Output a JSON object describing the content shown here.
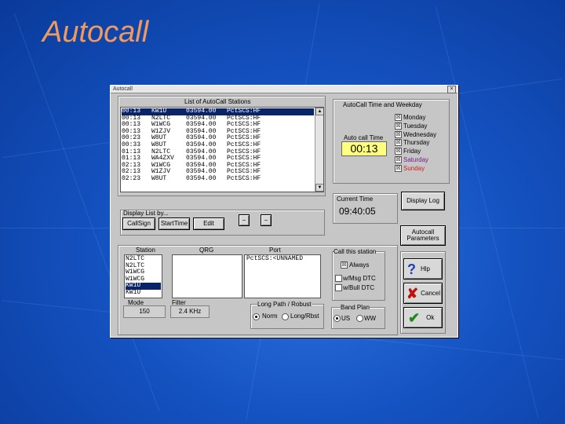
{
  "slide": {
    "title": "Autocall"
  },
  "window": {
    "title": "Autocall",
    "close": "×"
  },
  "stations_list": {
    "title": "List of AutoCall Stations",
    "rows": [
      {
        "time": "00:13",
        "call": "KW1U",
        "freq": "03594.00",
        "port": "PctSCS:HF",
        "selected": true
      },
      {
        "time": "00:13",
        "call": "N2LTC",
        "freq": "03594.00",
        "port": "PctSCS:HF",
        "selected": false
      },
      {
        "time": "00:13",
        "call": "W1WCG",
        "freq": "03594.00",
        "port": "PctSCS:HF",
        "selected": false
      },
      {
        "time": "00:13",
        "call": "W1ZJV",
        "freq": "03594.00",
        "port": "PctSCS:HF",
        "selected": false
      },
      {
        "time": "00:23",
        "call": "W8UT",
        "freq": "03594.00",
        "port": "PctSCS:HF",
        "selected": false
      },
      {
        "time": "00:33",
        "call": "W8UT",
        "freq": "03594.00",
        "port": "PctSCS:HF",
        "selected": false
      },
      {
        "time": "01:13",
        "call": "N2LTC",
        "freq": "03594.00",
        "port": "PctSCS:HF",
        "selected": false
      },
      {
        "time": "01:13",
        "call": "WA4ZXV",
        "freq": "03594.00",
        "port": "PctSCS:HF",
        "selected": false
      },
      {
        "time": "02:13",
        "call": "W1WCG",
        "freq": "03594.00",
        "port": "PctSCS:HF",
        "selected": false
      },
      {
        "time": "02:13",
        "call": "W1ZJV",
        "freq": "03594.00",
        "port": "PctSCS:HF",
        "selected": false
      },
      {
        "time": "02:23",
        "call": "W8UT",
        "freq": "03594.00",
        "port": "PctSCS:HF",
        "selected": false
      }
    ]
  },
  "display_list": {
    "label": "Display List by...",
    "callsign": "CallSign",
    "starttime": "StartTime",
    "edit": "Edit",
    "minus1": "−",
    "minus2": "−"
  },
  "autocall_time": {
    "title": "AutoCall Time and Weekday",
    "auto_call_time_label": "Auto call Time",
    "time_value": "00:13",
    "days": [
      {
        "name": "Monday",
        "checked": "☒",
        "color": "#000000"
      },
      {
        "name": "Tuesday",
        "checked": "☒",
        "color": "#000000"
      },
      {
        "name": "Wednesday",
        "checked": "☒",
        "color": "#000000"
      },
      {
        "name": "Thursday",
        "checked": "☒",
        "color": "#000000"
      },
      {
        "name": "Friday",
        "checked": "☒",
        "color": "#000000"
      },
      {
        "name": "Saturday",
        "checked": "☒",
        "color": "#7a1a8a"
      },
      {
        "name": "Sunday",
        "checked": "☒",
        "color": "#d02020"
      }
    ]
  },
  "current_time": {
    "label": "Current Time",
    "value": "09:40:05"
  },
  "display_log": "Display Log",
  "autocall_params": {
    "line1": "Autocall",
    "line2": "Parameters"
  },
  "station_sel": {
    "station_label": "Station",
    "stations": [
      {
        "call": "N2LTC",
        "selected": false
      },
      {
        "call": "N2LTC",
        "selected": false
      },
      {
        "call": "W1WCG",
        "selected": false
      },
      {
        "call": "W1WCG",
        "selected": false
      },
      {
        "call": "KW1U",
        "selected": true
      },
      {
        "call": "KW1U",
        "selected": false
      }
    ],
    "qrg_label": "QRG",
    "port_label": "Port",
    "port_value": "PctSCS:<UNNAMED",
    "mode_label": "Mode",
    "mode_value": "150",
    "filter_label": "Filter",
    "filter_value": "2.4 KHz"
  },
  "call_station": {
    "title": "Call this station",
    "always": "Always",
    "always_checked": "☒",
    "msg_dtc": "w/Msg DTC",
    "bull_dtc": "w/Bull DTC"
  },
  "long_path": {
    "title": "Long Path / Robust",
    "norm": "Norm",
    "long": "Long/Rbst"
  },
  "band_plan": {
    "title": "Band Plan",
    "us": "US",
    "ww": "WW"
  },
  "side_buttons": {
    "help": "Hlp",
    "cancel": "Cancel",
    "ok": "Ok",
    "help_glyph": "?",
    "cancel_glyph": "✘",
    "ok_glyph": "✔",
    "help_color": "#1b3fb8",
    "cancel_color": "#c01010",
    "ok_color": "#1a8a1a"
  }
}
